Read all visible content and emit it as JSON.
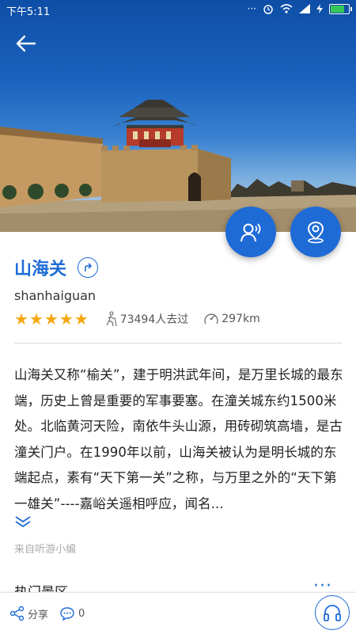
{
  "status": {
    "time": "下午5:11",
    "dots": "···"
  },
  "colors": {
    "accent": "#1f6bd6",
    "star": "#f6a70d",
    "muted": "#aaaaaa"
  },
  "icons": {
    "back": "arrow-left-icon",
    "guide": "person-voice-icon",
    "map": "map-pin-icon",
    "share": "share-icon",
    "comment": "comment-icon",
    "audio": "headphones-icon"
  },
  "spot": {
    "title": "山海关",
    "pinyin": "shanhaiguan",
    "rating": 5,
    "stars": [
      "★",
      "★",
      "★",
      "★",
      "★"
    ],
    "visitors": "73494人去过",
    "distance": "297km",
    "description": "山海关又称“榆关”，建于明洪武年间，是万里长城的最东端，历史上曾是重要的军事要塞。在潼关城东约1500米处。北临黄河天险，南依牛头山源，用砖砌筑高墙，是古潼关门户。在1990年以前，山海关被认为是明长城的东端起点，素有“天下第一关”之称，与万里之外的“天下第一雄关”----嘉峪关遥相呼应，闻名...",
    "source": "来自听游小编"
  },
  "section": {
    "title": "热门景区",
    "more": "···"
  },
  "bottom": {
    "share_label": "分享",
    "comment_count": "0"
  }
}
